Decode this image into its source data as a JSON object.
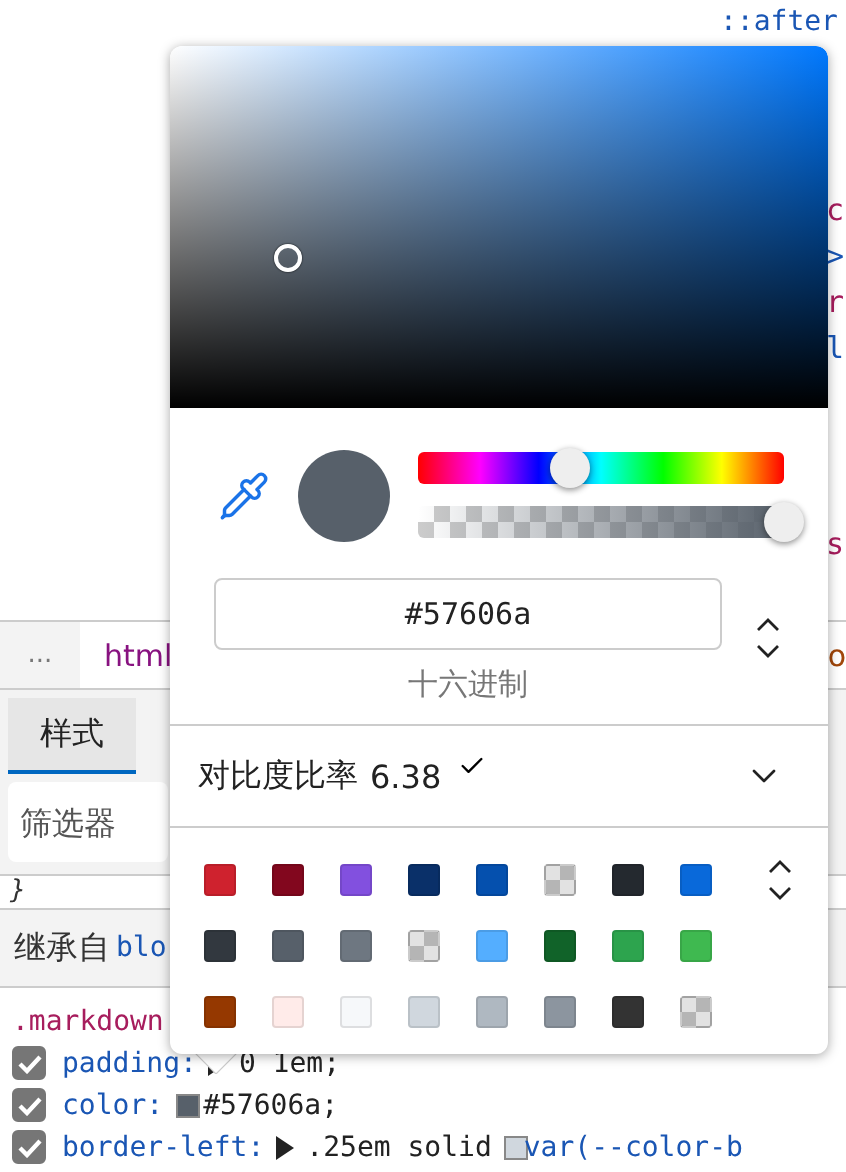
{
  "devtools": {
    "pseudo_element": "::after",
    "code_fragments": [
      "c",
      ">",
      "r",
      "l"
    ],
    "code_fragment_lower": "s",
    "breadcrumb": {
      "more": "...",
      "items": [
        "html"
      ],
      "trailing": "o"
    },
    "tabs": [
      {
        "label": "样式",
        "selected": true
      }
    ],
    "filter": {
      "placeholder": "筛选器"
    },
    "closing_brace": "}",
    "inherited": {
      "label": "继承自",
      "selector": "blo"
    },
    "rule": {
      "selector": ".markdown",
      "declarations": [
        {
          "checked": true,
          "property": "padding:",
          "parts": [
            {
              "kind": "expander"
            },
            {
              "kind": "text",
              "text": "0 1em;"
            }
          ]
        },
        {
          "checked": true,
          "property": "color:",
          "parts": [
            {
              "kind": "swatch",
              "color": "#57606a"
            },
            {
              "kind": "text",
              "text": "#57606a;"
            }
          ]
        },
        {
          "checked": true,
          "property": "border-left:",
          "parts": [
            {
              "kind": "expander"
            },
            {
              "kind": "text",
              "text": ".25em solid"
            },
            {
              "kind": "swatch",
              "color": "#d0d7de"
            },
            {
              "kind": "var",
              "text": "var(--color-b"
            }
          ]
        }
      ]
    }
  },
  "color_picker": {
    "hex": "#57606a",
    "hue": {
      "level": 0.417
    },
    "alpha": {
      "level": 1
    },
    "format_label": "十六进制",
    "contrast": {
      "label": "对比度比率",
      "value": "6.38",
      "passes": true,
      "expanded": false
    },
    "swatches": [
      {
        "kind": "solid",
        "color": "#cf222e"
      },
      {
        "kind": "solid",
        "color": "#82071e"
      },
      {
        "kind": "solid",
        "color": "#8250df"
      },
      {
        "kind": "solid",
        "color": "#0a3069"
      },
      {
        "kind": "solid",
        "color": "#0550ae"
      },
      {
        "kind": "checker"
      },
      {
        "kind": "solid",
        "color": "#24292f"
      },
      {
        "kind": "solid",
        "color": "#0969da"
      },
      {
        "kind": "solid",
        "color": "#32383f"
      },
      {
        "kind": "solid",
        "color": "#57606a"
      },
      {
        "kind": "solid",
        "color": "#6e7781"
      },
      {
        "kind": "checker"
      },
      {
        "kind": "solid",
        "color": "#54aeff"
      },
      {
        "kind": "solid",
        "color": "#116329"
      },
      {
        "kind": "solid",
        "color": "#2da44e"
      },
      {
        "kind": "solid",
        "color": "#3fb950"
      },
      {
        "kind": "solid",
        "color": "#953800"
      },
      {
        "kind": "solid",
        "color": "#ffebe9"
      },
      {
        "kind": "solid",
        "color": "#f6f8fa"
      },
      {
        "kind": "solid",
        "color": "#d0d7de"
      },
      {
        "kind": "solid",
        "color": "#afb8c1"
      },
      {
        "kind": "solid",
        "color": "#8c959f"
      },
      {
        "kind": "solid",
        "color": "#333333"
      },
      {
        "kind": "checker"
      }
    ]
  }
}
